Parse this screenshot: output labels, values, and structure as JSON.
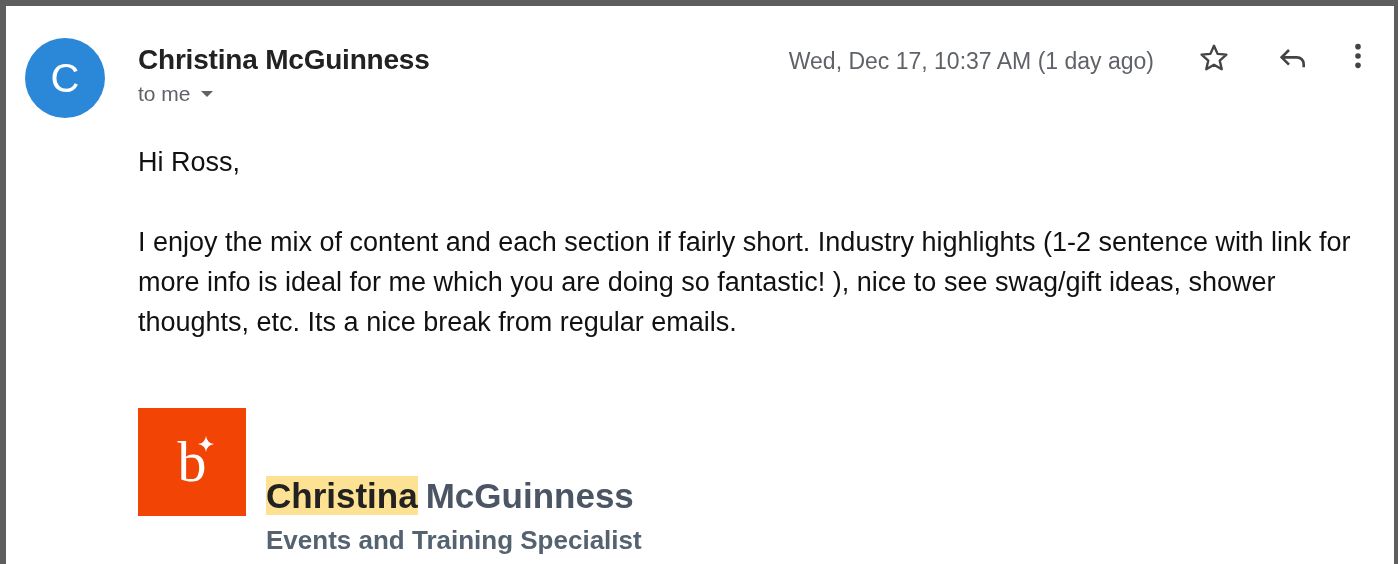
{
  "sender": {
    "avatar_letter": "C",
    "name": "Christina McGuinness",
    "recipient": "to me"
  },
  "date": "Wed, Dec 17, 10:37 AM (1 day ago)",
  "starred": false,
  "body": {
    "greeting": "Hi Ross,",
    "paragraph": "I enjoy the mix of content and each section if fairly short. Industry highlights (1-2 sentence with link for more info is ideal for me which you are doing so fantastic! ), nice to see swag/gift ideas, shower thoughts, etc. Its a nice break from regular emails."
  },
  "signature": {
    "logo_letter": "b",
    "name": [
      {
        "text": "Christina",
        "highlighted": true
      },
      {
        "text": "McGuinness",
        "highlighted": false
      }
    ],
    "title": "Events and Training Specialist"
  }
}
